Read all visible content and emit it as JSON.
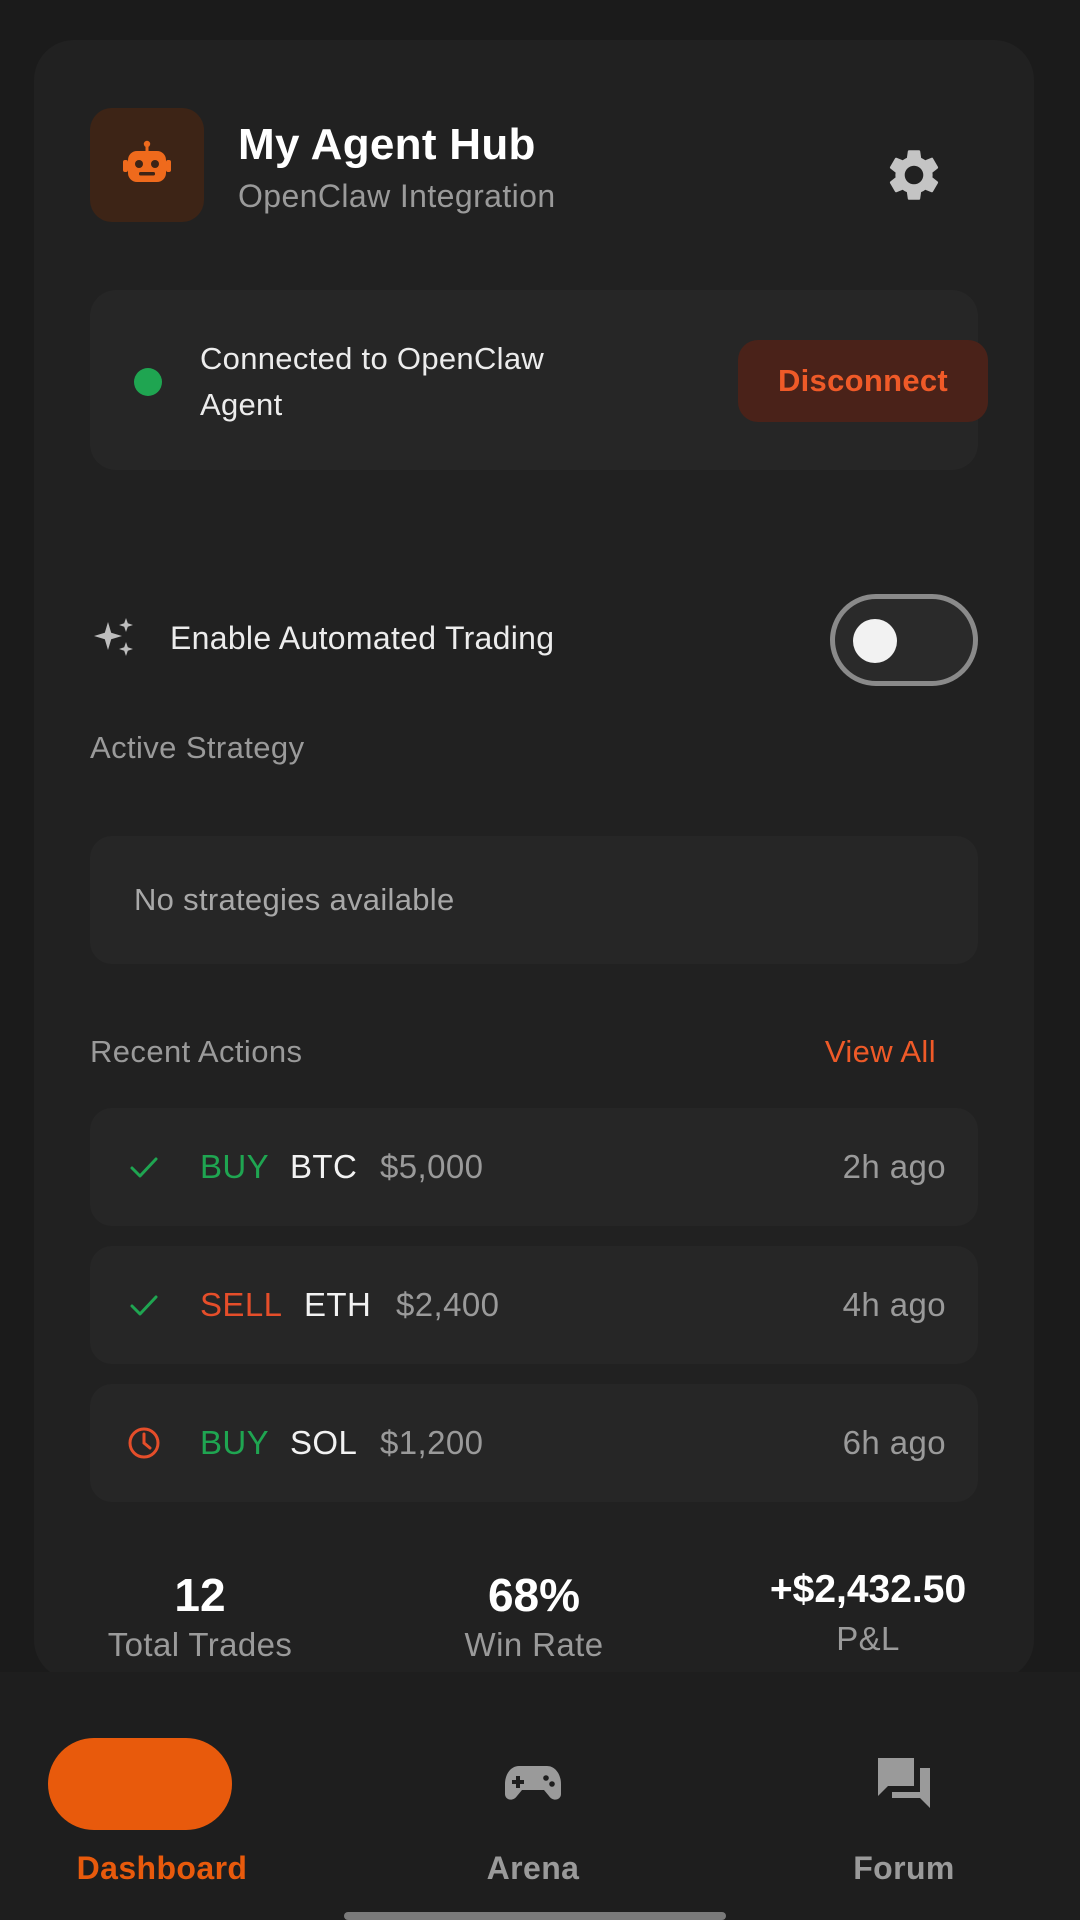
{
  "header": {
    "title": "My Agent Hub",
    "subtitle": "OpenClaw Integration",
    "icon": "robot-icon",
    "settings_icon": "gear-icon"
  },
  "connection": {
    "status_text": "Connected to OpenClaw Agent",
    "status_color": "#1fa551",
    "disconnect_label": "Disconnect"
  },
  "automation": {
    "icon": "sparkles-icon",
    "label": "Enable Automated Trading",
    "enabled": false
  },
  "strategy": {
    "section_label": "Active Strategy",
    "empty_text": "No strategies available"
  },
  "recent_actions": {
    "section_label": "Recent Actions",
    "view_all_label": "View All",
    "items": [
      {
        "status_icon": "check-icon",
        "side": "BUY",
        "asset": "BTC",
        "amount": "$5,000",
        "time": "2h ago"
      },
      {
        "status_icon": "check-icon",
        "side": "SELL",
        "asset": "ETH",
        "amount": "$2,400",
        "time": "4h ago"
      },
      {
        "status_icon": "clock-icon",
        "side": "BUY",
        "asset": "SOL",
        "amount": "$1,200",
        "time": "6h ago"
      }
    ]
  },
  "stats": [
    {
      "value": "12",
      "label": "Total Trades"
    },
    {
      "value": "68%",
      "label": "Win Rate"
    },
    {
      "value": "+$2,432.50",
      "label": "P&L"
    }
  ],
  "nav": {
    "active": "Dashboard",
    "items": [
      {
        "label": "Dashboard",
        "icon": "dashboard-icon"
      },
      {
        "label": "Arena",
        "icon": "gamepad-icon"
      },
      {
        "label": "Forum",
        "icon": "forum-icon"
      }
    ]
  },
  "colors": {
    "accent": "#e85a0c",
    "buy": "#1fa551",
    "sell": "#e54e2a",
    "background": "#1b1b1b",
    "card": "#212121"
  }
}
